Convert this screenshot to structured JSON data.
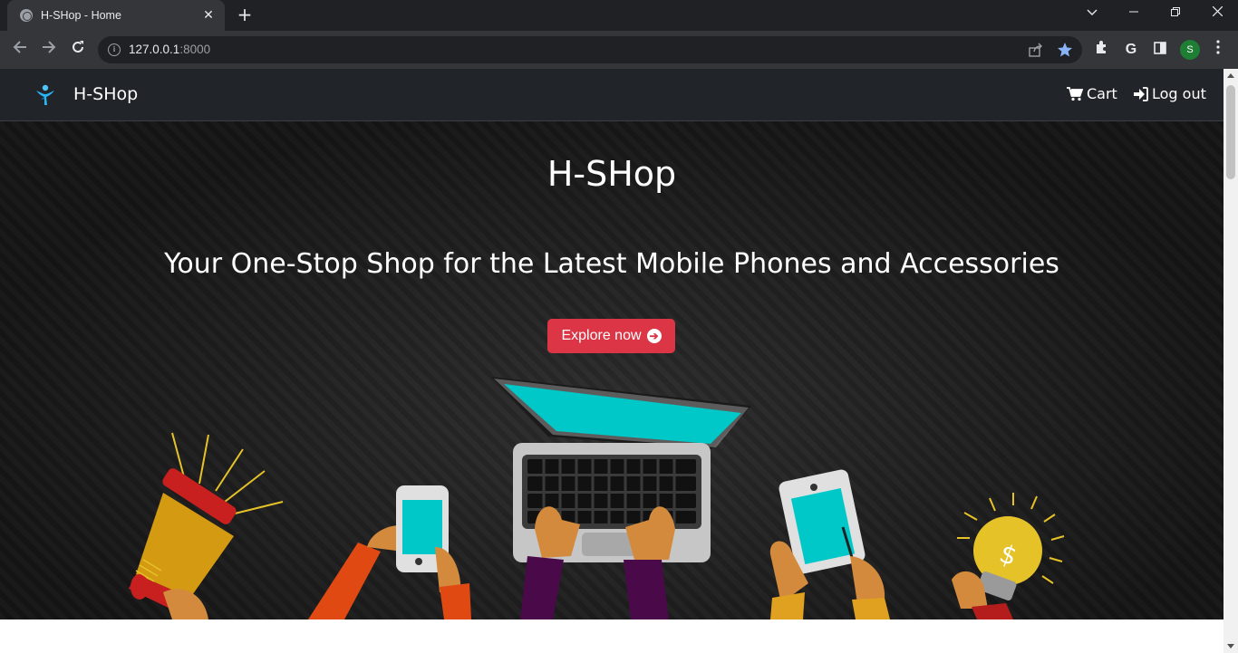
{
  "browser": {
    "tab_title": "H-SHop - Home",
    "tab_close": "✕",
    "new_tab": "+",
    "url_host": "127.0.0.1",
    "url_port": ":8000",
    "profile_initial": "S"
  },
  "navbar": {
    "brand": "H-SHop",
    "links": [
      {
        "label": "Cart",
        "icon": "cart-icon"
      },
      {
        "label": "Log out",
        "icon": "sign-out-icon"
      }
    ]
  },
  "hero": {
    "title": "H-SHop",
    "subtitle": "Your One-Stop Shop for the Latest Mobile Phones and Accessories",
    "cta_label": "Explore now",
    "cta_icon": "arrow-circle-right-icon"
  },
  "colors": {
    "navbar_bg": "#212529",
    "cta_bg": "#dc3545",
    "screen_cyan": "#00c8c8"
  }
}
